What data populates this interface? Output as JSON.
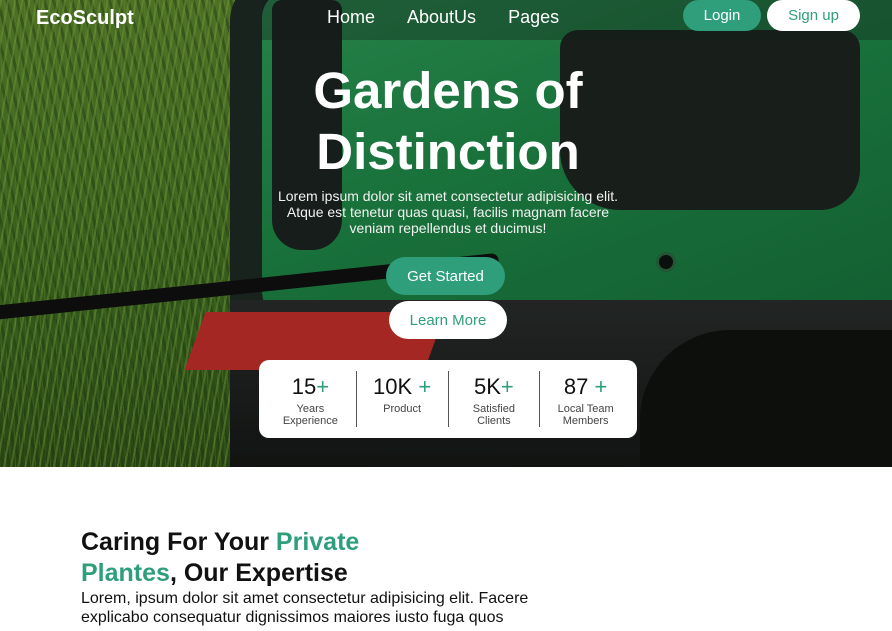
{
  "brand": {
    "logo": "EcoSculpt",
    "accent_color": "#2e9e7b"
  },
  "nav": {
    "links": [
      "Home",
      "AboutUs",
      "Pages"
    ],
    "login_label": "Login",
    "signup_label": "Sign up"
  },
  "hero": {
    "title_line1": "Gardens of",
    "title_line2": "Distinction",
    "description": "Lorem ipsum dolor sit amet consectetur adipisicing elit. Atque est tenetur quas quasi, facilis magnam facere veniam repellendus et ducimus!",
    "primary_button": "Get Started",
    "secondary_button": "Learn More"
  },
  "stats": [
    {
      "value": "15",
      "plus": "+",
      "label": "Years Experience"
    },
    {
      "value": "10K",
      "plus": "+",
      "label": "Product"
    },
    {
      "value": "5K",
      "plus": "+",
      "label": "Satisfied Clients"
    },
    {
      "value": "87",
      "plus": "+",
      "label": "Local Team Members"
    }
  ],
  "section": {
    "title_part1": "Caring For Your ",
    "title_accent1": "Private",
    "title_accent2": "Plantes",
    "title_part2": ", Our Expertise",
    "body": "Lorem, ipsum dolor sit amet consectetur adipisicing elit. Facere explicabo consequatur dignissimos maiores iusto fuga quos"
  }
}
